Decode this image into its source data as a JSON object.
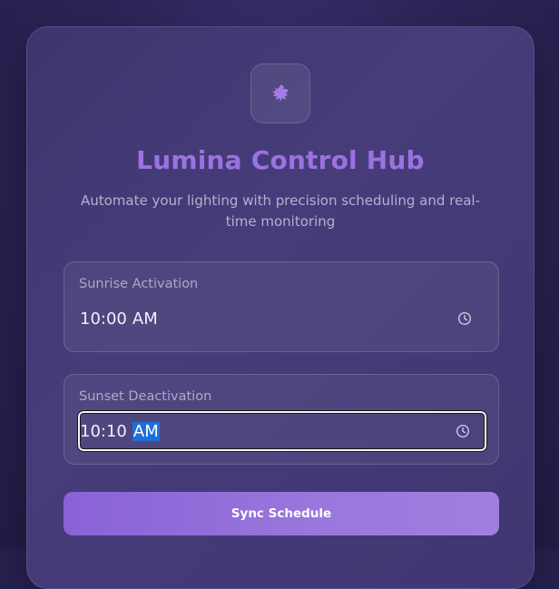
{
  "app": {
    "logo_icon": "dragon-bolt-icon",
    "title": "Lumina Control Hub",
    "subtitle": "Automate your lighting with precision scheduling and real-time monitoring"
  },
  "schedule": {
    "sunrise": {
      "label": "Sunrise Activation",
      "time": "10:00",
      "period": "AM",
      "icon": "clock-icon"
    },
    "sunset": {
      "label": "Sunset Deactivation",
      "time": "10:10",
      "period": "AM",
      "icon": "clock-icon",
      "focused": true,
      "selected_segment": "period"
    }
  },
  "actions": {
    "sync_label": "Sync Schedule"
  },
  "colors": {
    "accent": "#9b72e0",
    "background": "#2c2558",
    "card": "#433a77",
    "selection": "#1e6fd9",
    "button_start": "#8a62d6",
    "button_end": "#a07fde"
  }
}
